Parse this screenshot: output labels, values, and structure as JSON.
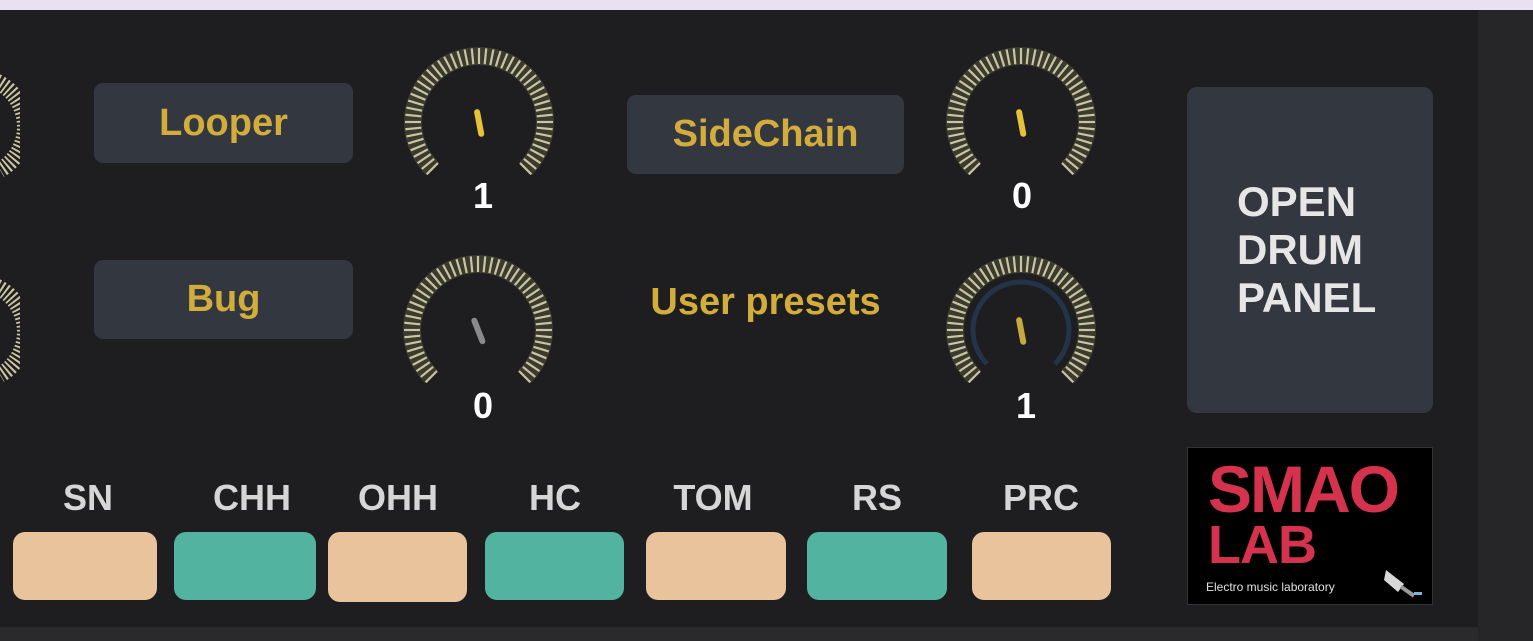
{
  "buttons": {
    "looper": "Looper",
    "sidechain": "SideChain",
    "bug": "Bug",
    "open_drum_panel": [
      "OPEN",
      "DRUM",
      "PANEL"
    ]
  },
  "labels": {
    "user_presets": "User presets"
  },
  "knobs": {
    "looper_knob": {
      "value": "1",
      "needle_color": "#e5c23a",
      "level": 0.46
    },
    "sidechain_knob": {
      "value": "0",
      "needle_color": "#e5c23a",
      "level": 0.46
    },
    "bug_knob": {
      "value": "0",
      "needle_color": "#8a8a8a",
      "level": 0.42
    },
    "user_presets_knob": {
      "value": "1",
      "needle_color": "#c8a93e",
      "level": 0.46,
      "track_color": "#233349"
    }
  },
  "drums": [
    {
      "label": "SN",
      "color": "#e8c39b"
    },
    {
      "label": "CHH",
      "color": "#52b3a0"
    },
    {
      "label": "OHH",
      "color": "#e8c39b"
    },
    {
      "label": "HC",
      "color": "#52b3a0"
    },
    {
      "label": "TOM",
      "color": "#e8c39b"
    },
    {
      "label": "RS",
      "color": "#52b3a0"
    },
    {
      "label": "PRC",
      "color": "#e8c39b"
    }
  ],
  "logo": {
    "line1": "SMAO",
    "line2": "LAB",
    "tagline": "Electro music laboratory",
    "brand_color": "#d5324e",
    "icon": "cleaver-icon"
  },
  "colors": {
    "accent_gold": "#d2ad3c",
    "button_bg": "#333740",
    "panel_bg": "#1e1e20",
    "knob_ring": "#c9c5a0"
  }
}
